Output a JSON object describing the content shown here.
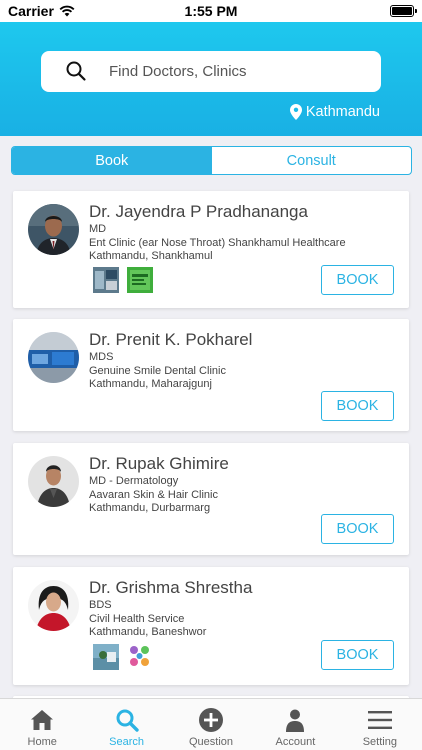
{
  "status": {
    "carrier": "Carrier",
    "time": "1:55 PM"
  },
  "search": {
    "placeholder": "Find Doctors, Clinics"
  },
  "location": "Kathmandu",
  "segment": {
    "book": "Book",
    "consult": "Consult"
  },
  "doctors": [
    {
      "name": "Dr. Jayendra P Pradhananga",
      "degree": "MD",
      "clinic": "Ent Clinic (ear Nose Throat) Shankhamul Healthcare",
      "address": "Kathmandu, Shankhamul",
      "book_label": "BOOK"
    },
    {
      "name": "Dr. Prenit K. Pokharel",
      "degree": "MDS",
      "clinic": "Genuine Smile Dental Clinic",
      "address": "Kathmandu, Maharajgunj",
      "book_label": "BOOK"
    },
    {
      "name": "Dr. Rupak Ghimire",
      "degree": "MD - Dermatology",
      "clinic": "Aavaran Skin & Hair Clinic",
      "address": "Kathmandu, Durbarmarg",
      "book_label": "BOOK"
    },
    {
      "name": "Dr. Grishma Shrestha",
      "degree": "BDS",
      "clinic": "Civil Health Service",
      "address": "Kathmandu, Baneshwor",
      "book_label": "BOOK"
    }
  ],
  "tabs": [
    {
      "label": "Home",
      "icon": "home-icon"
    },
    {
      "label": "Search",
      "icon": "search-icon"
    },
    {
      "label": "Question",
      "icon": "plus-circle-icon"
    },
    {
      "label": "Account",
      "icon": "person-icon"
    },
    {
      "label": "Setting",
      "icon": "menu-icon"
    }
  ],
  "colors": {
    "accent": "#2bb3e3",
    "header_top": "#1ec8ee",
    "header_bottom": "#19b0e4"
  }
}
